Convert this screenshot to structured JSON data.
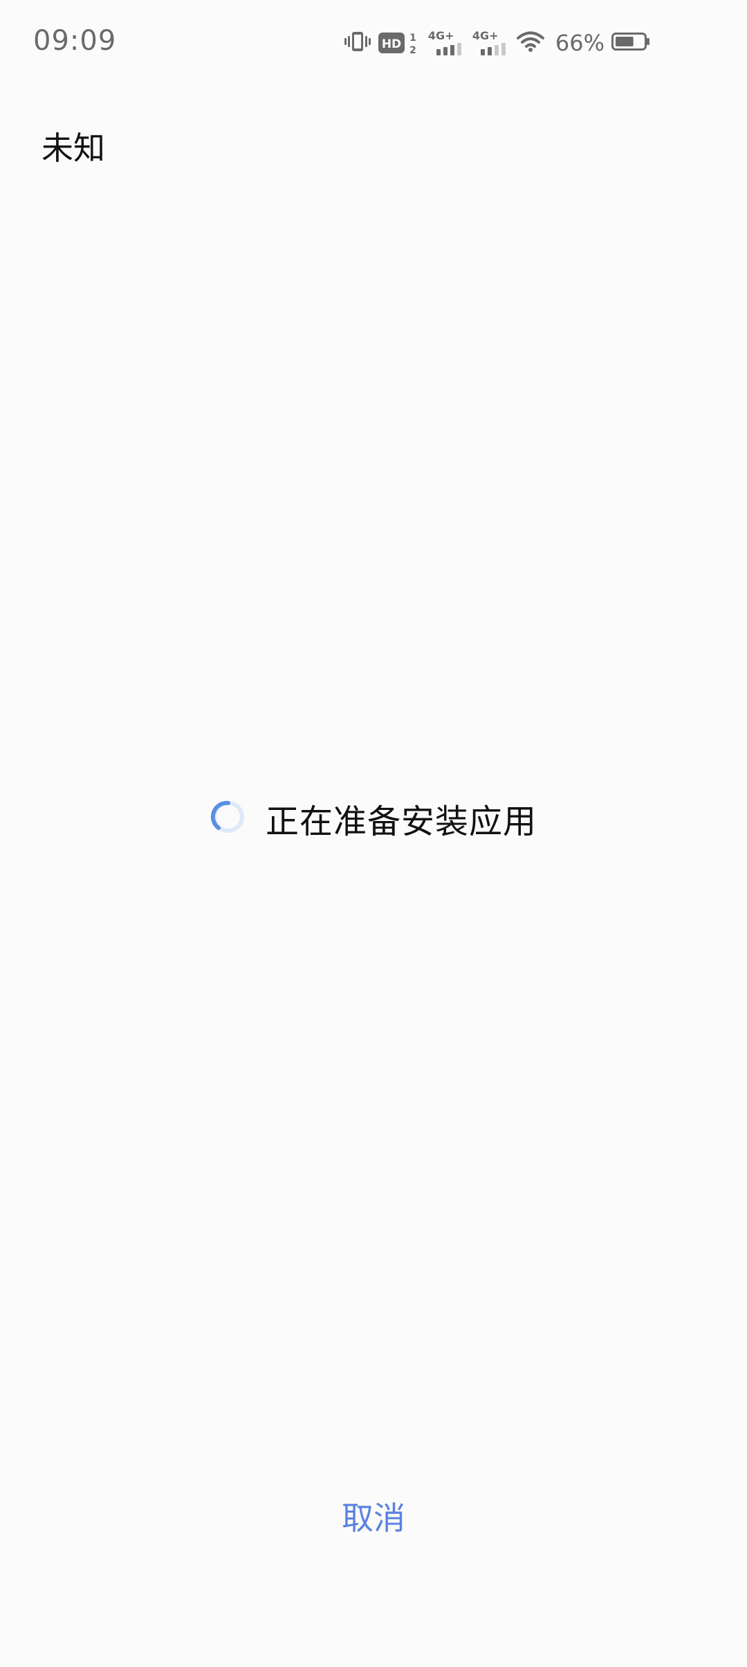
{
  "status_bar": {
    "time": "09:09",
    "icons": [
      "vibrate-icon",
      "hd-icon",
      "signal-icon",
      "signal-icon",
      "wifi-icon",
      "battery-icon"
    ],
    "hd_label": "HD",
    "hd_sim_top": "1",
    "hd_sim_bottom": "2",
    "network_1": "4G+",
    "network_2": "4G+",
    "battery_percent": "66%",
    "battery_level": 0.66
  },
  "header": {
    "title": "未知"
  },
  "loading": {
    "message": "正在准备安装应用",
    "accent_color": "#5a8fe0"
  },
  "footer": {
    "cancel_label": "取消",
    "cancel_color": "#5a82e0"
  }
}
